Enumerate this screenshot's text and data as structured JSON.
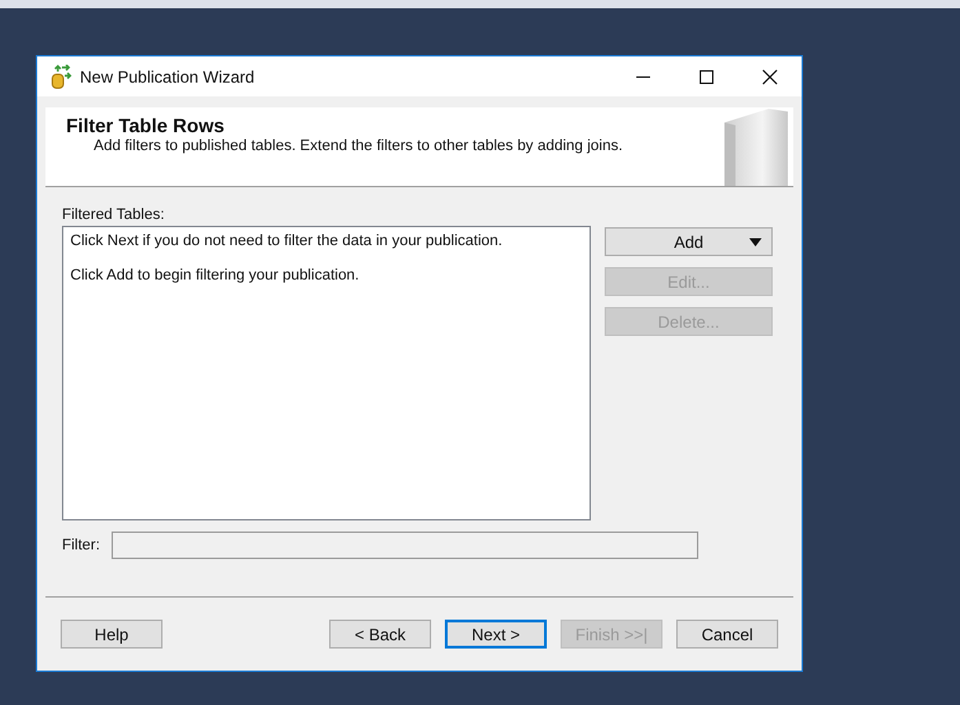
{
  "window": {
    "title": "New Publication Wizard"
  },
  "header": {
    "title": "Filter Table Rows",
    "subtitle": "Add filters to published tables. Extend the filters to other tables by adding joins."
  },
  "filtered_tables": {
    "label": "Filtered Tables:",
    "messages": [
      "Click Next if you do not need to filter the data in your publication.",
      "Click Add to begin filtering your publication."
    ]
  },
  "side_buttons": [
    {
      "label": "Add",
      "kind": "dropdown",
      "disabled": false
    },
    {
      "label": "Edit...",
      "kind": "plain",
      "disabled": true
    },
    {
      "label": "Delete...",
      "kind": "plain",
      "disabled": true
    }
  ],
  "filter": {
    "label": "Filter:"
  },
  "footer_buttons": [
    {
      "label": "Help",
      "disabled": false,
      "focused": false
    },
    {
      "label": "< Back",
      "disabled": false,
      "focused": false
    },
    {
      "label": "Next >",
      "disabled": false,
      "focused": true
    },
    {
      "label": "Finish >>|",
      "disabled": true,
      "focused": false
    },
    {
      "label": "Cancel",
      "disabled": false,
      "focused": false
    }
  ]
}
